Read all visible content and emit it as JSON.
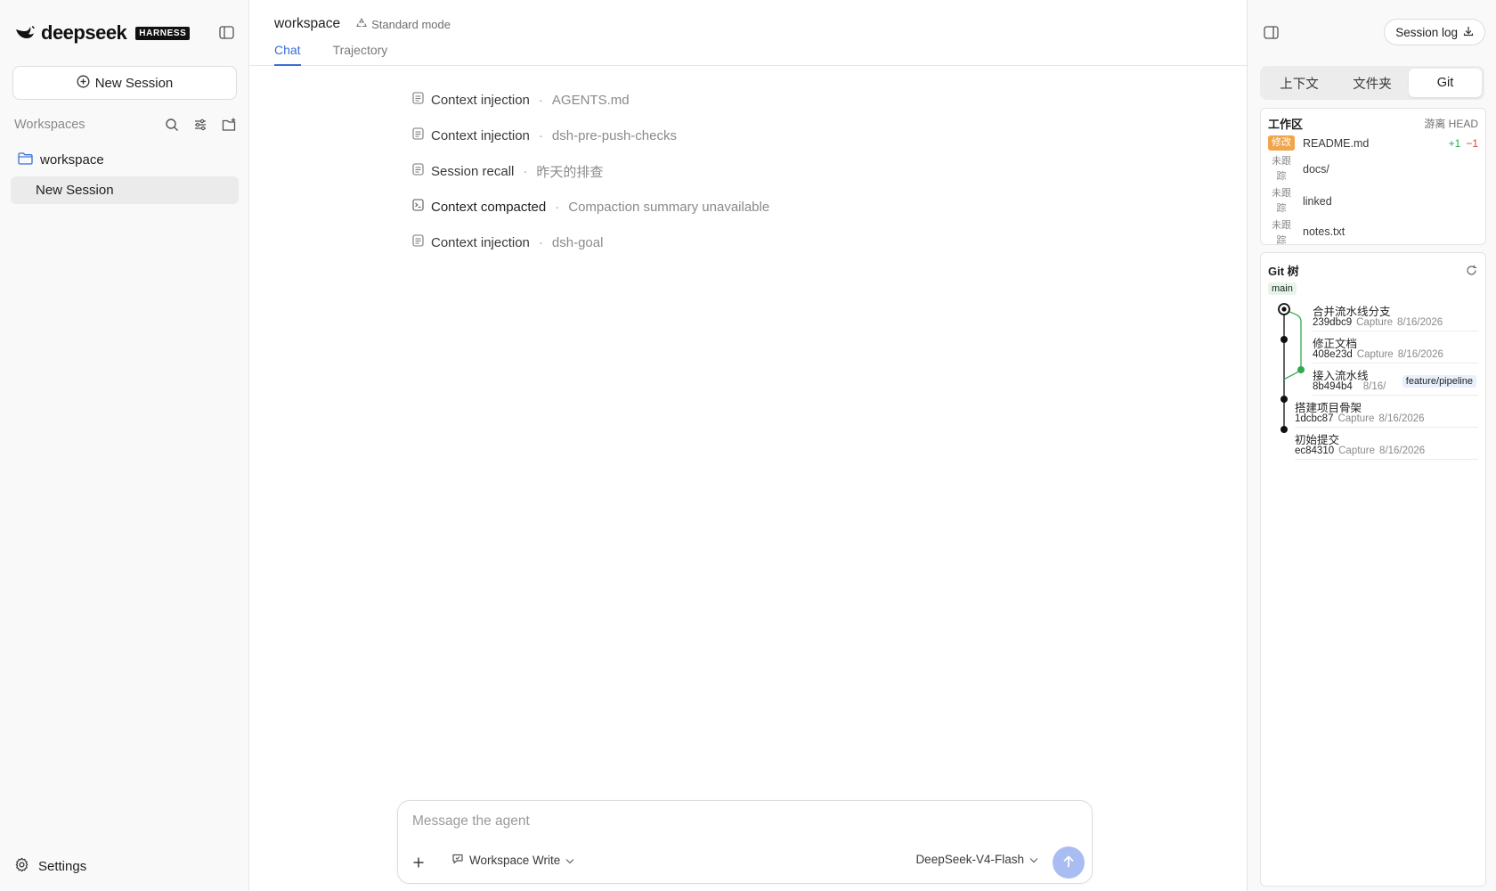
{
  "brand": {
    "name": "deepseek",
    "badge": "HARNESS"
  },
  "sidebar": {
    "new_session_label": "New Session",
    "workspaces_label": "Workspaces",
    "folder_label": "workspace",
    "session_label": "New Session",
    "settings_label": "Settings"
  },
  "header": {
    "workspace_title": "workspace",
    "mode_label": "Standard mode",
    "tabs": [
      {
        "label": "Chat",
        "active": true
      },
      {
        "label": "Trajectory",
        "active": false
      }
    ]
  },
  "events": [
    {
      "icon": "document-icon",
      "title": "Context injection",
      "detail": "AGENTS.md"
    },
    {
      "icon": "document-icon",
      "title": "Context injection",
      "detail": "dsh-pre-push-checks"
    },
    {
      "icon": "document-icon",
      "title": "Session recall",
      "detail": "昨天的排查"
    },
    {
      "icon": "terminal-icon",
      "title": "Context compacted",
      "detail": "Compaction summary unavailable"
    },
    {
      "icon": "document-icon",
      "title": "Context injection",
      "detail": "dsh-goal"
    }
  ],
  "composer": {
    "placeholder": "Message the agent",
    "permission": "Workspace Write",
    "model": "DeepSeek-V4-Flash"
  },
  "right_panel": {
    "session_log_label": "Session log",
    "tabs": [
      {
        "label": "上下文",
        "active": false
      },
      {
        "label": "文件夹",
        "active": false
      },
      {
        "label": "Git",
        "active": true
      }
    ],
    "worktree": {
      "title": "工作区",
      "status": "游离 HEAD",
      "files": [
        {
          "badge": "修改",
          "name": "README.md",
          "added": "+1",
          "removed": "−1"
        },
        {
          "badge": "未跟踪",
          "name": "docs/"
        },
        {
          "badge": "未跟踪",
          "name": "linked"
        },
        {
          "badge": "未跟踪",
          "name": "notes.txt"
        }
      ]
    },
    "git_tree": {
      "title": "Git 树",
      "branch": "main",
      "commits": [
        {
          "message": "合并流水线分支",
          "hash": "239dbc9",
          "author": "Capture",
          "date": "8/16/2026",
          "ref": ""
        },
        {
          "message": "修正文档",
          "hash": "408e23d",
          "author": "Capture",
          "date": "8/16/2026",
          "ref": ""
        },
        {
          "message": "接入流水线",
          "hash": "8b494b4",
          "author": "",
          "date": "8/16/",
          "ref": "feature/pipeline"
        },
        {
          "message": "搭建项目骨架",
          "hash": "1dcbc87",
          "author": "Capture",
          "date": "8/16/2026",
          "ref": ""
        },
        {
          "message": "初始提交",
          "hash": "ec84310",
          "author": "Capture",
          "date": "8/16/2026",
          "ref": ""
        }
      ]
    }
  },
  "colors": {
    "accent": "#3a6fd8",
    "send_button": "#a9bdf3",
    "modified_badge": "#f1a54a",
    "branch_line": "#2eaa4f"
  }
}
